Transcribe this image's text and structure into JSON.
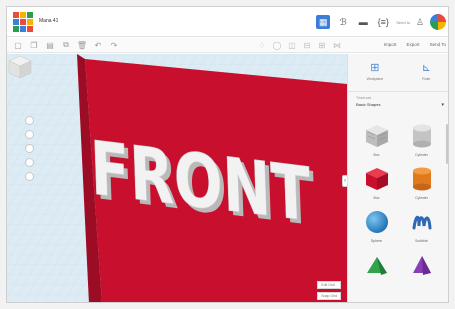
{
  "app": {
    "title": "Mana 41",
    "send_to": "Send to"
  },
  "colors": {
    "accent": "#3b7dd8",
    "box_red": "#c8102e",
    "workplane": "#dcebf4",
    "letters": "#f2f2f2"
  },
  "header": {
    "buttons": [
      {
        "name": "3d-view-icon",
        "active": true
      },
      {
        "name": "blocks-icon",
        "active": false
      },
      {
        "name": "bricks-icon",
        "active": false
      },
      {
        "name": "code-blocks-icon",
        "active": false
      }
    ]
  },
  "toolbar": {
    "tabs": [
      "Import",
      "Export",
      "Send To"
    ]
  },
  "scene": {
    "text": "FRONT"
  },
  "viewport": {
    "edit_grid": "Edit Grid",
    "snap_grid": "Snap Grid"
  },
  "panel": {
    "tools": [
      {
        "label": "Workplane",
        "icon": "workplane-icon"
      },
      {
        "label": "Ruler",
        "icon": "ruler-icon"
      }
    ],
    "library_label": "Tinkercad",
    "library_value": "Basic Shapes",
    "shapes": [
      {
        "name": "Box",
        "icon": "box-hole-icon"
      },
      {
        "name": "Cylinder",
        "icon": "cylinder-hole-icon"
      },
      {
        "name": "Box",
        "icon": "box-icon"
      },
      {
        "name": "Cylinder",
        "icon": "cylinder-icon"
      },
      {
        "name": "Sphere",
        "icon": "sphere-icon"
      },
      {
        "name": "Scribble",
        "icon": "scribble-icon"
      },
      {
        "name": "",
        "icon": "roof-icon"
      },
      {
        "name": "",
        "icon": "cone-icon"
      }
    ]
  }
}
